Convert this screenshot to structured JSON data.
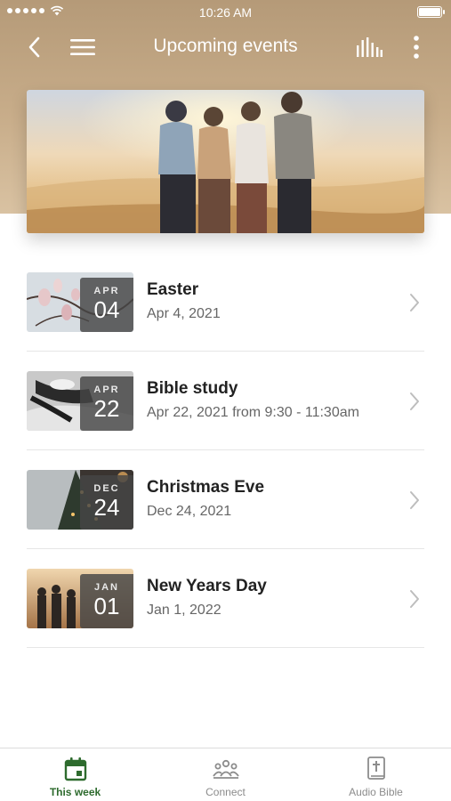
{
  "status_bar": {
    "time": "10:26 AM"
  },
  "nav": {
    "title": "Upcoming events",
    "back_icon": "chevron-left-icon",
    "menu_icon": "hamburger-menu-icon",
    "audio_icon": "equalizer-icon",
    "more_icon": "more-vertical-icon"
  },
  "hero": {
    "image": "friends-embracing-at-sunset-photo"
  },
  "events": [
    {
      "month": "APR",
      "day": "04",
      "title": "Easter",
      "date": "Apr 4, 2021",
      "thumb": "magnolia-blossoms-photo"
    },
    {
      "month": "APR",
      "day": "22",
      "title": "Bible study",
      "date": "Apr 22, 2021 from 9:30 - 11:30am",
      "thumb": "people-sitting-photo"
    },
    {
      "month": "DEC",
      "day": "24",
      "title": "Christmas Eve",
      "date": "Dec 24, 2021",
      "thumb": "pine-tree-lights-photo"
    },
    {
      "month": "JAN",
      "day": "01",
      "title": "New Years Day",
      "date": "Jan 1, 2022",
      "thumb": "group-at-sunset-photo"
    }
  ],
  "tabs": [
    {
      "label": "This week",
      "icon": "calendar-icon",
      "active": true
    },
    {
      "label": "Connect",
      "icon": "group-icon",
      "active": false
    },
    {
      "label": "Audio Bible",
      "icon": "bible-icon",
      "active": false
    }
  ],
  "colors": {
    "accent": "#2e6b2e",
    "header": "#c8ad8a",
    "muted": "#8c8c8c"
  }
}
